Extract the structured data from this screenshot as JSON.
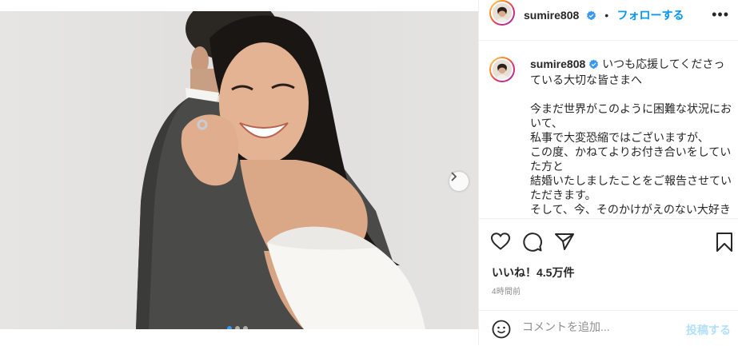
{
  "post": {
    "username": "sumire808",
    "separator": "•",
    "follow_label": "フォローする",
    "more_label": "•••",
    "caption": "いつも応援してくださっている大切な皆さまへ\n\n今まだ世界がこのように困難な状況において、\n私事で大変恐縮ではございますが、\nこの度、かねてよりお付き合いをしていた方と\n結婚いたしましたことをご報告させていただきます。\nそして、今、そのかけがえのない大好き",
    "likes": "いいね！4.5万件",
    "timestamp": "4時間前"
  },
  "comment": {
    "placeholder": "コメントを追加...",
    "post_label": "投稿する"
  },
  "carousel": {
    "slide_count": 3,
    "active_index": 0
  },
  "icons": {
    "verified": "verified-badge-icon",
    "next": "chevron-right-icon",
    "like": "heart-icon",
    "comment": "comment-icon",
    "share": "paper-plane-icon",
    "save": "bookmark-icon",
    "emoji": "emoji-icon"
  },
  "colors": {
    "accent": "#0095f6",
    "verified": "#3897f0",
    "post_disabled": "#b2dffc",
    "secondary_text": "#8e8e8e"
  }
}
